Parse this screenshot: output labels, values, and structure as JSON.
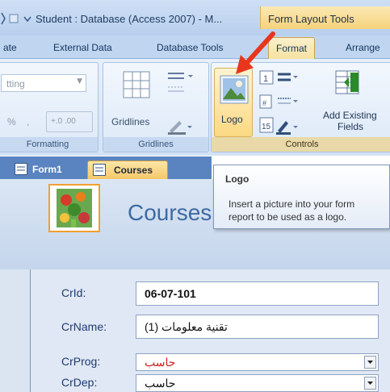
{
  "window": {
    "title": "Student : Database (Access 2007) - M...",
    "context_tab": "Form Layout Tools"
  },
  "ribbon_tabs": [
    "ate",
    "External Data",
    "Database Tools",
    "Format",
    "Arrange"
  ],
  "ribbon": {
    "formatting": {
      "label": "Formatting",
      "format_dropdown": "tting",
      "percent": "%",
      "comma": ",",
      "inc_decimal": "+.0 .00",
      "dec_decimal": ".00 +.0"
    },
    "gridlines": {
      "label": "Gridlines",
      "button_label": "Gridlines"
    },
    "controls": {
      "label": "Controls",
      "logo_label": "Logo",
      "add_fields_line1": "Add Existing",
      "add_fields_line2": "Fields"
    }
  },
  "document_tabs": [
    "Form1",
    "Courses"
  ],
  "form": {
    "title": "Courses",
    "fields": [
      {
        "label": "CrId:",
        "value": "06-07-101"
      },
      {
        "label": "CrName:",
        "value": "تقنية معلومات (1)"
      },
      {
        "label": "CrProg:",
        "value": "حاسب"
      },
      {
        "label": "CrDep:",
        "value": "حاسب"
      }
    ]
  },
  "tooltip": {
    "title": "Logo",
    "description": "Insert a picture into your form\nreport to be used as a logo."
  },
  "colors": {
    "accent": "#f6d27a",
    "arrow": "#e8361c",
    "form_title": "#3c6aa3",
    "crprog_value": "#cc2020"
  },
  "icons": [
    "access-quick-access-icon",
    "table-grid-icon",
    "logo-picture-icon",
    "add-existing-fields-icon",
    "red-arrow-annotation"
  ]
}
